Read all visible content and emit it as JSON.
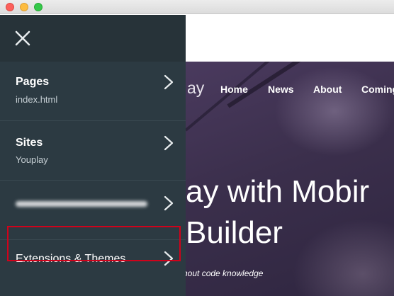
{
  "window": {
    "controls": [
      "close",
      "minimize",
      "zoom"
    ]
  },
  "site": {
    "logo_fragment": "ay",
    "nav": [
      {
        "label": "Home"
      },
      {
        "label": "News"
      },
      {
        "label": "About"
      },
      {
        "label": "Coming"
      }
    ],
    "headline_line1": "ay with Mobir",
    "headline_line2": "Builder",
    "subline": "hout code knowledge"
  },
  "drawer": {
    "close_icon": "close-icon",
    "items": [
      {
        "label": "Pages",
        "sub": "index.html",
        "icon": "chevron-right-icon"
      },
      {
        "label": "Sites",
        "sub": "Youplay",
        "icon": "chevron-right-icon"
      },
      {
        "label": "",
        "sub": "",
        "icon": "chevron-right-icon"
      },
      {
        "label": "Extensions & Themes",
        "sub": "",
        "icon": "chevron-right-icon",
        "highlighted": true
      }
    ]
  },
  "colors": {
    "drawer_bg": "#2c3a42",
    "highlight_border": "#d0021b",
    "hero_bg": "#3b2f4c"
  }
}
